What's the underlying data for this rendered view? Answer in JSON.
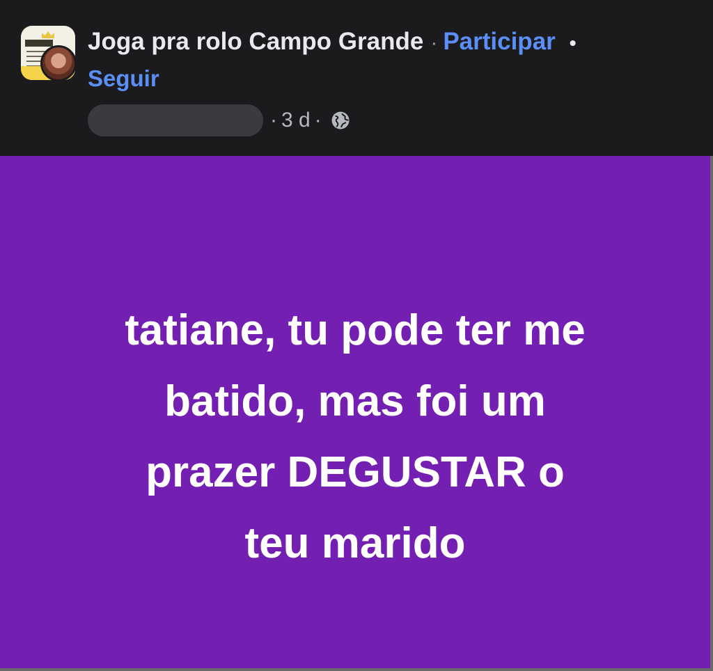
{
  "header": {
    "group_name": "Joga pra rolo Campo Grande",
    "separator": "·",
    "join_label": "Participar",
    "bullet": "•",
    "follow_label": "Seguir",
    "time_ago": "3 d",
    "audience_icon": "globe-icon",
    "link_color": "#5b8ff6"
  },
  "post": {
    "background_color": "#7320b2",
    "lines": [
      "tatiane, tu pode ter me",
      "batido, mas foi um",
      "prazer DEGUSTAR o",
      "teu marido"
    ]
  }
}
